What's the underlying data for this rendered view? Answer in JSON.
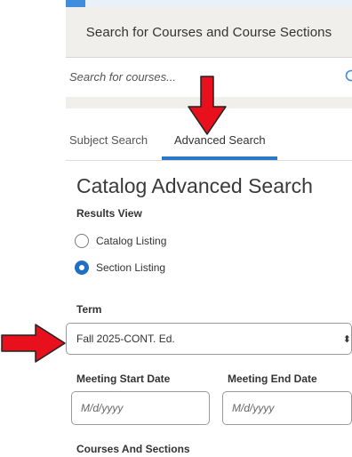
{
  "search": {
    "header_title": "Search for Courses and Course Sections",
    "placeholder": "Search for courses..."
  },
  "tabs": [
    {
      "label": "Subject Search",
      "active": false
    },
    {
      "label": "Advanced Search",
      "active": true
    }
  ],
  "catalog": {
    "title": "Catalog Advanced Search",
    "results_view_label": "Results View",
    "options": [
      {
        "label": "Catalog Listing",
        "selected": false
      },
      {
        "label": "Section Listing",
        "selected": true
      }
    ],
    "term_label": "Term",
    "term_value": "Fall 2025-CONT. Ed.",
    "meeting_start_label": "Meeting Start Date",
    "meeting_end_label": "Meeting End Date",
    "date_placeholder": "M/d/yyyy",
    "courses_sections_label": "Courses And Sections"
  },
  "colors": {
    "accent": "#2a79c8",
    "annotation_arrow": "#e8101c"
  },
  "icons": {
    "search": "search-icon",
    "select_chevron": "chevron-up-down-icon",
    "annotation_down": "red-arrow-down-icon",
    "annotation_right": "red-arrow-right-icon"
  }
}
